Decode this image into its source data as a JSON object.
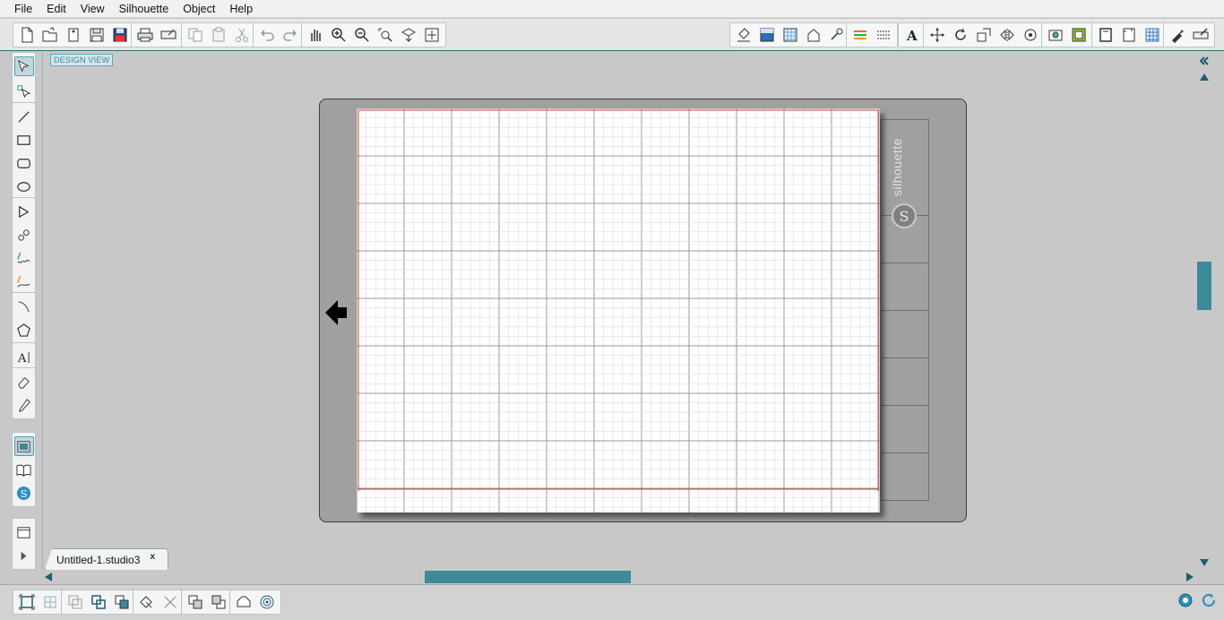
{
  "menu": {
    "items": [
      {
        "label": "File"
      },
      {
        "label": "Edit"
      },
      {
        "label": "View"
      },
      {
        "label": "Silhouette"
      },
      {
        "label": "Object"
      },
      {
        "label": "Help"
      }
    ]
  },
  "canvas": {
    "design_view_label": "DESIGN VIEW",
    "brand_text": "silhouette",
    "brand_logo": "S"
  },
  "tabs": [
    {
      "label": "Untitled-1.studio3",
      "close": "x",
      "active": true
    }
  ],
  "scroll": {
    "vertical_thumb_fraction": 0.45,
    "horizontal_thumb_fraction": 0.34
  },
  "colors": {
    "accent": "#3d8a99",
    "mat": "#a0a0a0",
    "margin_line": "#d94040",
    "grid_major": "#9a9a9a",
    "grid_minor": "#dcdcdc"
  }
}
